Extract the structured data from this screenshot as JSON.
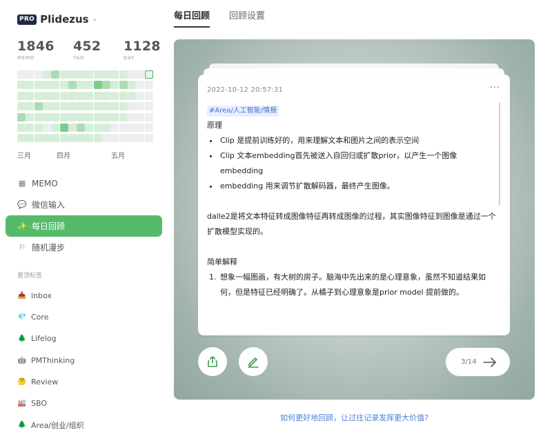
{
  "brand": {
    "badge": "PRO",
    "name": "Plidezus",
    "caret": "⌄"
  },
  "stats": [
    {
      "num": "1846",
      "label": "MEMO"
    },
    {
      "num": "452",
      "label": "TAG"
    },
    {
      "num": "1128",
      "label": "DAY"
    }
  ],
  "heatmap": {
    "colors": [
      "#eeeeee",
      "#d6eed9",
      "#acdcb3",
      "#7ccb8b"
    ],
    "today_border": "#5aa56a",
    "weeks": [
      [
        0,
        1,
        1,
        1,
        2,
        1,
        1
      ],
      [
        0,
        1,
        1,
        1,
        1,
        1,
        1
      ],
      [
        0,
        1,
        1,
        2,
        1,
        1,
        1
      ],
      [
        1,
        1,
        1,
        1,
        1,
        0,
        1
      ],
      [
        2,
        1,
        1,
        1,
        1,
        1,
        1
      ],
      [
        1,
        1,
        1,
        1,
        1,
        3,
        1
      ],
      [
        1,
        2,
        1,
        1,
        1,
        1,
        1
      ],
      [
        1,
        1,
        1,
        1,
        1,
        2,
        1
      ],
      [
        1,
        1,
        1,
        1,
        1,
        1,
        1
      ],
      [
        1,
        3,
        1,
        1,
        1,
        1,
        1
      ],
      [
        1,
        2,
        1,
        1,
        1,
        1,
        0
      ],
      [
        1,
        1,
        1,
        1,
        1,
        0,
        0
      ],
      [
        1,
        2,
        1,
        1,
        1,
        0,
        0
      ],
      [
        0,
        1,
        1,
        0,
        0,
        0,
        0
      ],
      [
        0,
        0,
        0,
        0,
        0,
        0,
        0
      ],
      [
        1,
        0,
        0,
        0,
        0,
        0,
        0
      ]
    ],
    "last_week_today_index": 0,
    "months": [
      "三月",
      "四月",
      "五月"
    ]
  },
  "nav": [
    {
      "icon": "grid-icon",
      "glyph": "▦",
      "label": "MEMO",
      "active": false
    },
    {
      "icon": "chat-icon",
      "glyph": "💬",
      "label": "微信输入",
      "active": false
    },
    {
      "icon": "sparkle-icon",
      "glyph": "✨",
      "label": "每日回顾",
      "active": true
    },
    {
      "icon": "signpost-icon",
      "glyph": "⚐",
      "label": "随机漫步",
      "active": false
    }
  ],
  "tags_title": "置顶标签",
  "tags": [
    {
      "icon": "inbox-icon",
      "glyph": "📥",
      "label": "inbox"
    },
    {
      "icon": "gem-icon",
      "glyph": "💎",
      "label": "Core"
    },
    {
      "icon": "tree-icon",
      "glyph": "🌲",
      "label": "Lifelog"
    },
    {
      "icon": "robot-icon",
      "glyph": "🤖",
      "label": "PMThinking"
    },
    {
      "icon": "thinking-face-icon",
      "glyph": "🤔",
      "label": "Review"
    },
    {
      "icon": "building-icon",
      "glyph": "🏭",
      "label": "SBO"
    },
    {
      "icon": "tree-icon",
      "glyph": "🌲",
      "label": "Area/创业/组织"
    }
  ],
  "tabs": [
    {
      "label": "每日回顾",
      "active": true
    },
    {
      "label": "回顾设置",
      "active": false
    }
  ],
  "card": {
    "time": "2022-10-12 20:57:31",
    "more": "···",
    "tag": "#Area/人工智能/情报",
    "heading1": "原理",
    "bullets": [
      "Clip 是提前训练好的，用来理解文本和图片之间的表示空间",
      "Clip 文本embedding首先被送入自回归或扩散prior，以产生一个图像embedding",
      "embedding 用来调节扩散解码器，最终产生图像。"
    ],
    "para": "dalle2是将文本特征转成图像特征再转成图像的过程，其实图像特征到图像是通过一个扩散模型实现的。",
    "heading2": "简单解释",
    "ordered": [
      "想象一幅图画，有大树的房子。脑海中先出来的是心理意象，虽然不知道结果如何，但是特征已经明确了。从橘子到心理意象是prior model 提前做的。"
    ]
  },
  "pager": {
    "text": "3/14"
  },
  "bottom_link": "如何更好地回顾，让过往记录发挥更大价值?",
  "colors": {
    "accent": "#55bb6a",
    "link": "#4a7fd6",
    "brand_badge": "#1f2a44"
  }
}
